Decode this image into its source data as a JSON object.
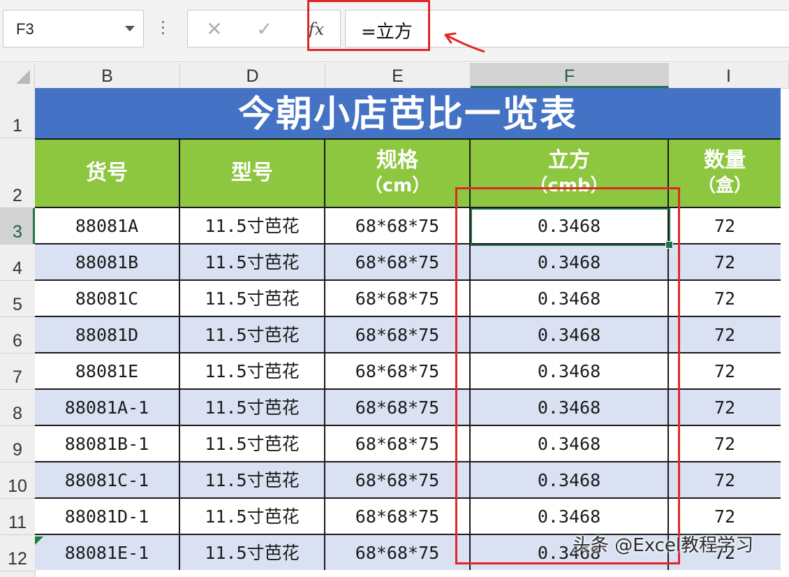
{
  "formula_bar": {
    "name_box": "F3",
    "cancel_icon": "✕",
    "confirm_icon": "✓",
    "fx_label": "fx",
    "formula": "=立方"
  },
  "columns": [
    {
      "letter": "B"
    },
    {
      "letter": "D"
    },
    {
      "letter": "E"
    },
    {
      "letter": "F"
    },
    {
      "letter": "I"
    }
  ],
  "rows": [
    "1",
    "2",
    "3",
    "4",
    "5",
    "6",
    "7",
    "8",
    "9",
    "10",
    "11",
    "12"
  ],
  "table": {
    "title": "今朝小店芭比一览表",
    "headers": [
      {
        "l1": "货号",
        "l2": ""
      },
      {
        "l1": "型号",
        "l2": ""
      },
      {
        "l1": "规格",
        "l2": "（cm）"
      },
      {
        "l1": "立方",
        "l2": "（cmb）"
      },
      {
        "l1": "数量",
        "l2": "（盒）"
      }
    ],
    "data": [
      [
        "88081A",
        "11.5寸芭花",
        "68*68*75",
        "0.3468",
        "72"
      ],
      [
        "88081B",
        "11.5寸芭花",
        "68*68*75",
        "0.3468",
        "72"
      ],
      [
        "88081C",
        "11.5寸芭花",
        "68*68*75",
        "0.3468",
        "72"
      ],
      [
        "88081D",
        "11.5寸芭花",
        "68*68*75",
        "0.3468",
        "72"
      ],
      [
        "88081E",
        "11.5寸芭花",
        "68*68*75",
        "0.3468",
        "72"
      ],
      [
        "88081A-1",
        "11.5寸芭花",
        "68*68*75",
        "0.3468",
        "72"
      ],
      [
        "88081B-1",
        "11.5寸芭花",
        "68*68*75",
        "0.3468",
        "72"
      ],
      [
        "88081C-1",
        "11.5寸芭花",
        "68*68*75",
        "0.3468",
        "72"
      ],
      [
        "88081D-1",
        "11.5寸芭花",
        "68*68*75",
        "0.3468",
        "72"
      ],
      [
        "88081E-1",
        "11.5寸芭花",
        "68*68*75",
        "0.3468",
        "72"
      ]
    ]
  },
  "watermark": "头条 @Excel教程学习",
  "colors": {
    "title_bg": "#4472c4",
    "header_bg": "#8dc63f",
    "alt_row_bg": "#d9e1f2",
    "selection": "#217346",
    "highlight_red": "#e0262a"
  }
}
